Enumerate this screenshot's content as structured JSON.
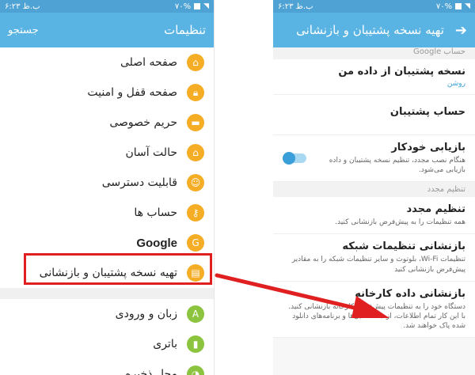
{
  "left": {
    "status": {
      "time": "۶:۲۳ ب.ظ",
      "battery": "۷۰%"
    },
    "appbar": {
      "title": "تنظیمات",
      "search": "جستجو"
    },
    "items": [
      {
        "label": "صفحه اصلی",
        "icon": "home-icon"
      },
      {
        "label": "صفحه قفل و امنیت",
        "icon": "lock-icon"
      },
      {
        "label": "حریم خصوصی",
        "icon": "privacy-icon"
      },
      {
        "label": "حالت آسان",
        "icon": "easy-mode-icon"
      },
      {
        "label": "قابلیت دسترسی",
        "icon": "accessibility-icon"
      },
      {
        "label": "حساب ها",
        "icon": "key-icon"
      },
      {
        "label": "Google",
        "icon": "google-icon"
      },
      {
        "label": "تهیه نسخه پشتیبان و بازنشانی",
        "icon": "backup-icon"
      }
    ],
    "items2": [
      {
        "label": "زبان و ورودی",
        "icon": "language-icon"
      },
      {
        "label": "باتری",
        "icon": "battery-icon"
      },
      {
        "label": "محل ذخیره",
        "icon": "storage-icon"
      }
    ]
  },
  "right": {
    "status": {
      "time": "۶:۲۳ ب.ظ",
      "battery": "۷۰%"
    },
    "appbar": {
      "title": "تهیه نسخه پشتیبان و بازنشانی"
    },
    "section_google": "حساب Google",
    "backup": {
      "title": "نسخه پشتیبان از داده من",
      "status": "روشن"
    },
    "account": {
      "title": "حساب پشتیبان"
    },
    "auto_restore": {
      "title": "بازیابی خودکار",
      "desc": "هنگام نصب مجدد، تنظیم نسخه پشتیبان و داده بازیابی می‌شود."
    },
    "section_reset": "تنظیم مجدد",
    "reset": {
      "title": "تنظیم مجدد",
      "desc": "همه تنظیمات را به پیش‌فرض بازنشانی کنید."
    },
    "network_reset": {
      "title": "بازنشانی تنظیمات شبکه",
      "desc": "تنظیمات Wi-Fi، بلوتوث و سایر تنظیمات شبکه را به مقادیر پیش‌فرض بازنشانی کنید"
    },
    "factory_reset": {
      "title": "بازنشانی داده کارخانه",
      "desc": "دستگاه خود را به تنظیمات پیش‌فرض کارخانه بازنشانی کنید. با این کار تمام اطلاعات، از جمله فایل‌ها و برنامه‌های دانلود شده پاک خواهند شد."
    }
  },
  "colors": {
    "accent": "#59b4e4",
    "icon_orange": "#f4ad24",
    "icon_green": "#8cc43f",
    "highlight": "#e02020"
  }
}
